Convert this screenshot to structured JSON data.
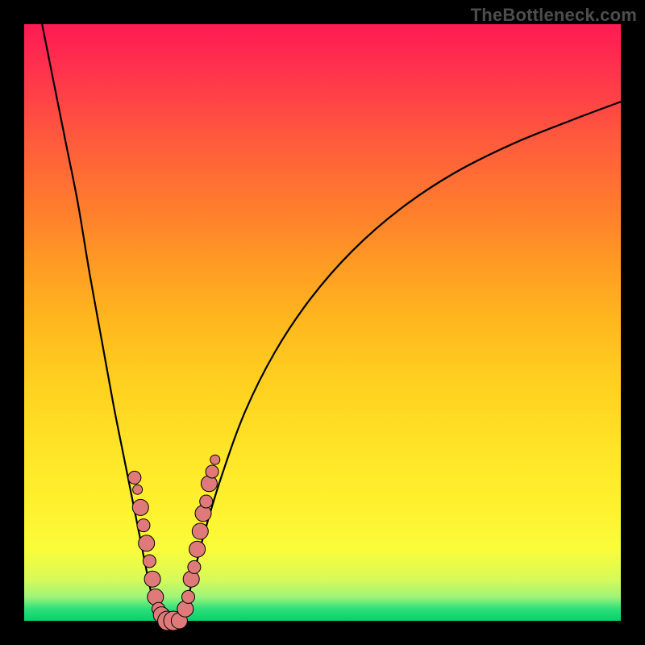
{
  "watermark": "TheBottleneck.com",
  "colors": {
    "frame": "#000000",
    "curve_stroke": "#000000",
    "marker_fill": "#e07a7a",
    "marker_stroke": "#000000"
  },
  "chart_data": {
    "type": "line",
    "title": "",
    "xlabel": "",
    "ylabel": "",
    "xlim": [
      0,
      100
    ],
    "ylim": [
      0,
      100
    ],
    "series": [
      {
        "name": "bottleneck-curve-left",
        "x": [
          3,
          5,
          7,
          9,
          11,
          13,
          15,
          17,
          19,
          21,
          22,
          23
        ],
        "y": [
          100,
          90,
          80,
          70,
          58,
          47,
          36,
          26,
          16,
          6,
          2,
          0
        ]
      },
      {
        "name": "bottleneck-curve-right",
        "x": [
          26,
          27,
          28,
          30,
          33,
          37,
          42,
          48,
          55,
          63,
          72,
          82,
          92,
          100
        ],
        "y": [
          0,
          2,
          6,
          14,
          24,
          35,
          45,
          54,
          62,
          69,
          75,
          80,
          84,
          87
        ]
      }
    ],
    "markers": [
      {
        "x": 18.5,
        "y": 24,
        "size": 8
      },
      {
        "x": 19.0,
        "y": 22,
        "size": 6
      },
      {
        "x": 19.5,
        "y": 19,
        "size": 10
      },
      {
        "x": 20.0,
        "y": 16,
        "size": 8
      },
      {
        "x": 20.5,
        "y": 13,
        "size": 10
      },
      {
        "x": 21.0,
        "y": 10,
        "size": 8
      },
      {
        "x": 21.5,
        "y": 7,
        "size": 10
      },
      {
        "x": 22.0,
        "y": 4,
        "size": 10
      },
      {
        "x": 22.5,
        "y": 2,
        "size": 8
      },
      {
        "x": 23.0,
        "y": 1,
        "size": 10
      },
      {
        "x": 24.0,
        "y": 0,
        "size": 12
      },
      {
        "x": 25.0,
        "y": 0,
        "size": 12
      },
      {
        "x": 26.0,
        "y": 0,
        "size": 10
      },
      {
        "x": 27.0,
        "y": 2,
        "size": 10
      },
      {
        "x": 27.5,
        "y": 4,
        "size": 8
      },
      {
        "x": 28.0,
        "y": 7,
        "size": 10
      },
      {
        "x": 28.5,
        "y": 9,
        "size": 8
      },
      {
        "x": 29.0,
        "y": 12,
        "size": 10
      },
      {
        "x": 29.5,
        "y": 15,
        "size": 10
      },
      {
        "x": 30.0,
        "y": 18,
        "size": 10
      },
      {
        "x": 30.5,
        "y": 20,
        "size": 8
      },
      {
        "x": 31.0,
        "y": 23,
        "size": 10
      },
      {
        "x": 31.5,
        "y": 25,
        "size": 8
      },
      {
        "x": 32.0,
        "y": 27,
        "size": 6
      }
    ],
    "annotations": []
  }
}
